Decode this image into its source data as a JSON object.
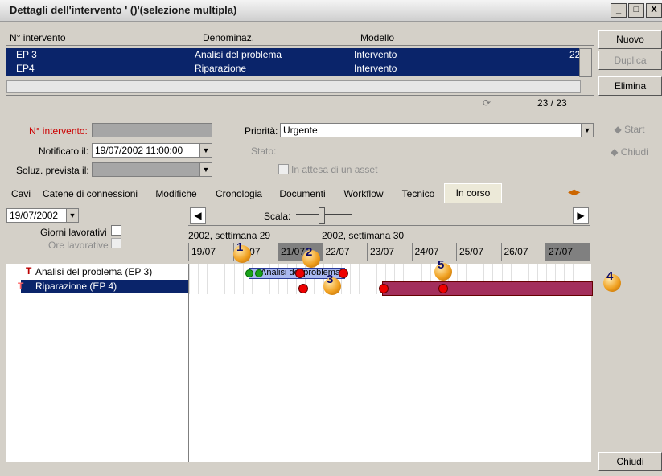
{
  "window": {
    "title": "Dettagli dell'intervento ' ()'(selezione multipla)"
  },
  "list": {
    "headers": [
      "N° intervento",
      "Denominaz.",
      "Modello"
    ],
    "rows": [
      {
        "n": "EP 3",
        "den": "Analisi del problema",
        "mod": "Intervento",
        "extra": "22"
      },
      {
        "n": "EP4",
        "den": "Riparazione",
        "mod": "Intervento",
        "extra": ""
      }
    ],
    "counter": "23 / 23"
  },
  "side_buttons": {
    "nuovo": "Nuovo",
    "duplica": "Duplica",
    "elimina": "Elimina",
    "start": "Start",
    "chiudi_top": "Chiudi",
    "chiudi_bottom": "Chiudi"
  },
  "form": {
    "n_intervento_label": "N° intervento:",
    "notificato_label": "Notificato il:",
    "notificato_value": "19/07/2002 11:00:00",
    "soluz_label": "Soluz. prevista il:",
    "priorita_label": "Priorità:",
    "priorita_value": "Urgente",
    "stato_label": "Stato:",
    "attesa_label": "In attesa di un asset"
  },
  "tabs": [
    "Cavi",
    "Catene di connessioni",
    "Modifiche",
    "Cronologia",
    "Documenti",
    "Workflow",
    "Tecnico",
    "In corso"
  ],
  "planning": {
    "date": "19/07/2002",
    "giorni_label": "Giorni lavorativi",
    "ore_label": "Ore lavorative",
    "scala_label": "Scala:",
    "week1": "2002, settimana 29",
    "week2": "2002, settimana 30",
    "days": [
      "19/07",
      "20/07",
      "21/07",
      "22/07",
      "23/07",
      "24/07",
      "25/07",
      "26/07",
      "27/07"
    ],
    "tasks": [
      "Analisi del problema (EP 3)",
      "Riparazione (EP 4)"
    ],
    "bar_label": "Analisi del problema"
  },
  "callouts": [
    "1",
    "2",
    "3",
    "4",
    "5"
  ]
}
